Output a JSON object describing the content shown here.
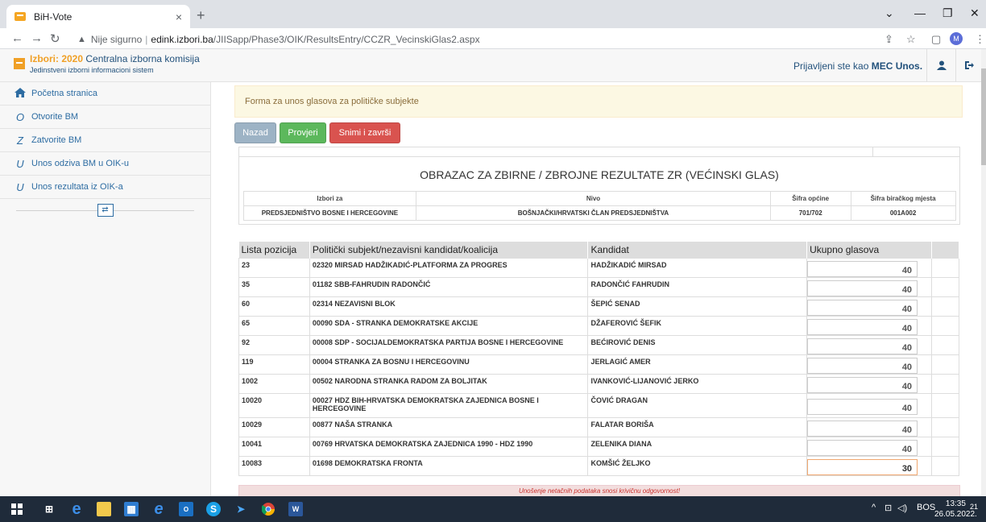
{
  "browser": {
    "tab_title": "BiH-Vote",
    "tab_close": "×",
    "new_tab": "+",
    "security_label": "Nije sigurno",
    "host": "edink.izbori.ba",
    "path": "/JIISapp/Phase3/OIK/ResultsEntry/CCZR_VecinskiGlas2.aspx",
    "profile_initial": "M"
  },
  "header": {
    "brand_prefix": "Izbori: 2020",
    "brand_name": "Centralna izborna komisija",
    "subtitle": "Jedinstveni izborni informacioni sistem",
    "logged_in_label": "Prijavljeni ste kao",
    "logged_in_user": "MEC Unos."
  },
  "sidebar": {
    "items": [
      {
        "label": "Početna stranica",
        "icon": "home-icon"
      },
      {
        "label": "Otvorite BM",
        "glyph": "O"
      },
      {
        "label": "Zatvorite BM",
        "glyph": "Z"
      },
      {
        "label": "Unos odziva BM u OIK-u",
        "glyph": "U"
      },
      {
        "label": "Unos rezultata iz OIK-a",
        "glyph": "U"
      }
    ]
  },
  "main": {
    "alert": "Forma za unos glasova za političke subjekte",
    "buttons": {
      "back": "Nazad",
      "check": "Provjeri",
      "save": "Snimi i završi"
    },
    "form_title": "OBRAZAC ZA ZBIRNE / ZBROJNE REZULTATE ZR (VEĆINSKI GLAS)",
    "meta": {
      "headers": [
        "Izbori za",
        "Nivo",
        "Šifra općine",
        "Šifra biračkog mjesta"
      ],
      "values": [
        "PREDSJEDNIŠTVO BOSNE I HERCEGOVINE",
        "BOŠNJAČKI/HRVATSKI ČLAN PREDSJEDNIŠTVA",
        "701/702",
        "001A002"
      ]
    },
    "results": {
      "headers": [
        "Lista pozicija",
        "Politički subjekt/nezavisni kandidat/koalicija",
        "Kandidat",
        "Ukupno glasova"
      ],
      "rows": [
        {
          "pos": "23",
          "subject": "02320 MIRSAD HADŽIKADIĆ-PLATFORMA ZA PROGRES",
          "candidate": "HADŽIKADIĆ MIRSAD",
          "votes": "40"
        },
        {
          "pos": "35",
          "subject": "01182 SBB-FAHRUDIN RADONČIĆ",
          "candidate": "RADONČIĆ FAHRUDIN",
          "votes": "40"
        },
        {
          "pos": "60",
          "subject": "02314 NEZAVISNI BLOK",
          "candidate": "ŠEPIĆ SENAD",
          "votes": "40"
        },
        {
          "pos": "65",
          "subject": "00090 SDA - STRANKA DEMOKRATSKE AKCIJE",
          "candidate": "DŽAFEROVIĆ ŠEFIK",
          "votes": "40"
        },
        {
          "pos": "92",
          "subject": "00008 SDP - SOCIJALDEMOKRATSKA PARTIJA BOSNE I HERCEGOVINE",
          "candidate": "BEĆIROVIĆ DENIS",
          "votes": "40"
        },
        {
          "pos": "119",
          "subject": "00004 STRANKA ZA BOSNU I HERCEGOVINU",
          "candidate": "JERLAGIĆ AMER",
          "votes": "40"
        },
        {
          "pos": "1002",
          "subject": "00502 NARODNA STRANKA RADOM ZA BOLJITAK",
          "candidate": "IVANKOVIĆ-LIJANOVIĆ JERKO",
          "votes": "40"
        },
        {
          "pos": "10020",
          "subject": "00027 HDZ BIH-HRVATSKA DEMOKRATSKA ZAJEDNICA BOSNE I HERCEGOVINE",
          "candidate": "ČOVIĆ DRAGAN",
          "votes": "40"
        },
        {
          "pos": "10029",
          "subject": "00877 NAŠA STRANKA",
          "candidate": "FALATAR BORIŠA",
          "votes": "40"
        },
        {
          "pos": "10041",
          "subject": "00769 HRVATSKA DEMOKRATSKA ZAJEDNICA 1990 - HDZ 1990",
          "candidate": "ZELENIKA DIANA",
          "votes": "40"
        },
        {
          "pos": "10083",
          "subject": "01698 DEMOKRATSKA FRONTA",
          "candidate": "KOMŠIĆ ŽELJKO",
          "votes": "30"
        }
      ]
    },
    "footer_warning": "Unošenje netačnih podataka snosi krivičnu odgovornost!"
  },
  "taskbar": {
    "language": "BOS",
    "time": "13:35",
    "date": "26.05.2022.",
    "notifications": "21"
  }
}
